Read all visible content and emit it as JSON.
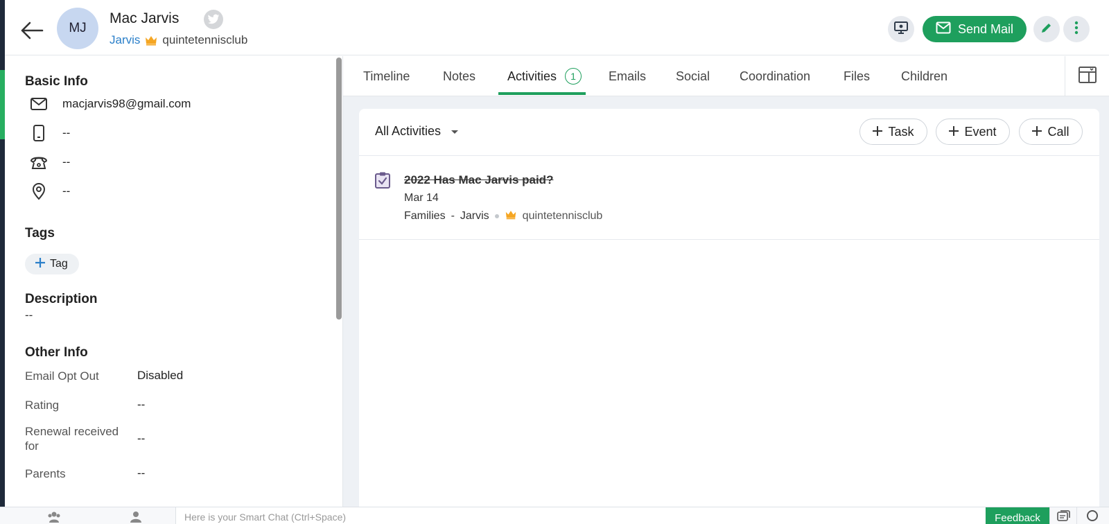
{
  "header": {
    "avatar_initials": "MJ",
    "name": "Mac Jarvis",
    "account_link": "Jarvis",
    "org": "quintetennisclub",
    "send_mail_label": "Send Mail"
  },
  "basic_info": {
    "title": "Basic Info",
    "email": "macjarvis98@gmail.com",
    "mobile": "--",
    "phone": "--",
    "address": "--"
  },
  "tags": {
    "title": "Tags",
    "add_label": "Tag"
  },
  "description": {
    "title": "Description",
    "value": "--"
  },
  "other_info": {
    "title": "Other Info",
    "fields": [
      {
        "label": "Email Opt Out",
        "value": "Disabled"
      },
      {
        "label": "Rating",
        "value": "--"
      },
      {
        "label": "Renewal received for",
        "value": "--"
      },
      {
        "label": "Parents",
        "value": "--"
      }
    ]
  },
  "tabs": [
    {
      "label": "Timeline"
    },
    {
      "label": "Notes"
    },
    {
      "label": "Activities",
      "badge": "1"
    },
    {
      "label": "Emails"
    },
    {
      "label": "Social"
    },
    {
      "label": "Coordination"
    },
    {
      "label": "Files"
    },
    {
      "label": "Children"
    }
  ],
  "activities": {
    "filter_label": "All Activities",
    "add_task": "Task",
    "add_event": "Event",
    "add_call": "Call",
    "items": [
      {
        "title": "2022 Has Mac Jarvis paid?",
        "date": "Mar 14",
        "module": "Families",
        "separator": "-",
        "related": "Jarvis",
        "org": "quintetennisclub"
      }
    ]
  },
  "bottom_bar": {
    "smart_chat_placeholder": "Here is your Smart Chat (Ctrl+Space)",
    "feedback_label": "Feedback"
  },
  "colors": {
    "accent_green": "#1e9f5d",
    "link_blue": "#2a7fc9",
    "crown_orange": "#f5a623"
  }
}
